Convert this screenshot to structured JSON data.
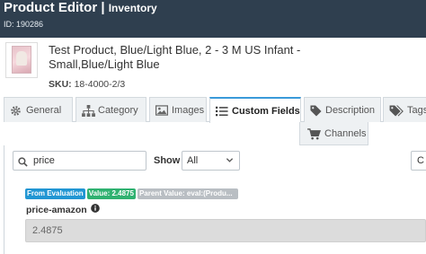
{
  "header": {
    "title": "Product Editor",
    "separator": "|",
    "section": "Inventory",
    "id_text": "ID: 190286"
  },
  "product": {
    "title": "Test Product, Blue/Light Blue, 2 - 3 M US Infant - Small,Blue/Light Blue",
    "sku_label": "SKU:",
    "sku_value": "18-4000-2/3"
  },
  "tabs": [
    {
      "label": "General",
      "icon": "gear-icon"
    },
    {
      "label": "Category",
      "icon": "sitemap-icon"
    },
    {
      "label": "Images",
      "icon": "image-icon"
    },
    {
      "label": "Custom Fields",
      "icon": "list-icon",
      "active": true
    },
    {
      "label": "Description",
      "icon": "tag-icon"
    },
    {
      "label": "Tags",
      "icon": "tags-icon"
    },
    {
      "label": "Channels",
      "icon": "cart-icon"
    }
  ],
  "filters": {
    "search_value": "price",
    "show_label": "Show",
    "show_selected": "All",
    "right_button_text": "C"
  },
  "field": {
    "badges": {
      "from": "From Evaluation",
      "value": "Value: 2.4875",
      "parent": "Parent Value: eval:(Produ..."
    },
    "name": "price-amazon",
    "value": "2.4875"
  },
  "colors": {
    "header_bg": "#2f3f4f",
    "active_tab_accent": "#3a9ad9",
    "badge_blue": "#2196d3",
    "badge_green": "#2fb170",
    "badge_gray": "#b9bec3"
  }
}
